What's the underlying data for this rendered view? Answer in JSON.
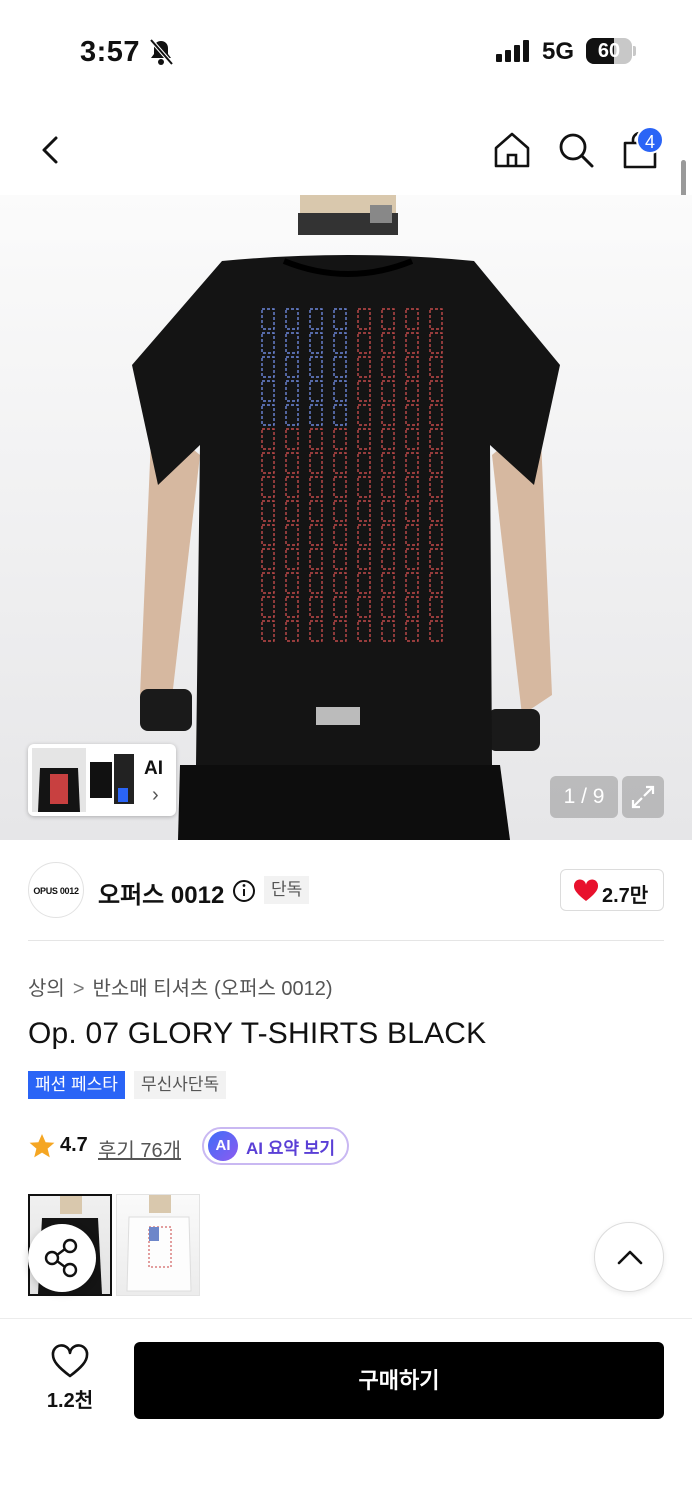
{
  "status_bar": {
    "time": "3:57",
    "network": "5G",
    "battery": "60",
    "battery_level": 0.6,
    "icons": [
      "bell-slash-icon",
      "signal-icon",
      "battery-icon"
    ]
  },
  "nav": {
    "cart_badge": "4",
    "icons": [
      "back-icon",
      "home-icon",
      "search-icon",
      "cart-icon"
    ]
  },
  "gallery": {
    "thumb_chip_label": "AI",
    "counter": "1 / 9"
  },
  "brand": {
    "logo_text": "OPUS 0012",
    "name": "오퍼스 0012",
    "tag": "단독",
    "likes": "2.7만"
  },
  "product": {
    "breadcrumb": [
      "상의",
      "반소매 티셔츠 (오퍼스 0012)"
    ],
    "title": "Op. 07 GLORY T-SHIRTS BLACK",
    "badges": [
      "패션 페스타",
      "무신사단독"
    ],
    "rating": "4.7",
    "reviews": "후기 76개",
    "ai_badge": "AI",
    "ai_summary": "AI 요약 보기"
  },
  "bottom_bar": {
    "wish_count": "1.2천",
    "buy_label": "구매하기"
  },
  "colors": {
    "accent_blue": "#2a64f6",
    "heart_red": "#e8112d",
    "star_orange": "#f5a623"
  }
}
